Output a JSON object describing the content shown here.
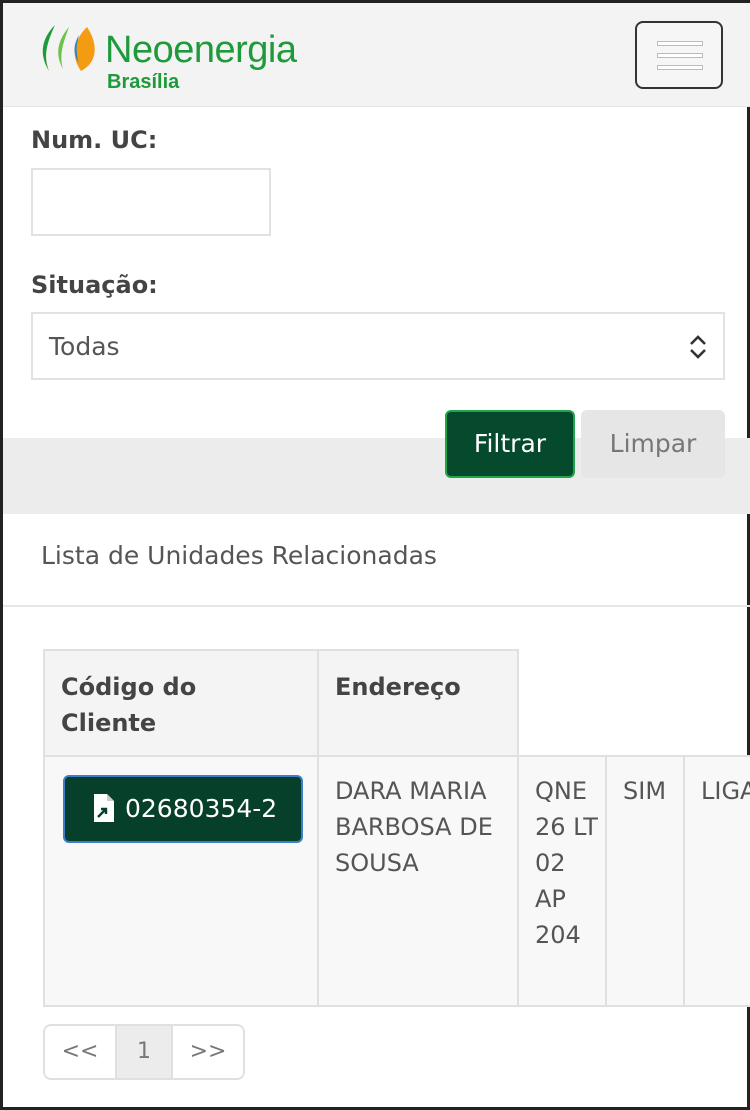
{
  "brand": {
    "name": "Neoenergia",
    "region": "Brasília",
    "colors": {
      "primary": "#1f9a3a",
      "dark": "#064a2e"
    }
  },
  "header": {
    "menu_icon": "hamburger-menu-icon"
  },
  "filters": {
    "uc_label": "Num. UC:",
    "uc_value": "",
    "situacao_label": "Situação:",
    "situacao_selected": "Todas",
    "filter_button": "Filtrar",
    "clear_button": "Limpar"
  },
  "list": {
    "title": "Lista de Unidades Relacionadas",
    "columns": [
      "Código do Cliente",
      "Endereço"
    ],
    "rows": [
      {
        "code": "02680354-2",
        "code_icon": "document-export-icon",
        "name": "DARA MARIA BARBOSA DE SOUSA",
        "address": "QNE 26 LT 02 AP 204",
        "flag": "SIM",
        "status": "LIGA"
      }
    ]
  },
  "pagination": {
    "prev": "<<",
    "current": "1",
    "next": ">>"
  }
}
